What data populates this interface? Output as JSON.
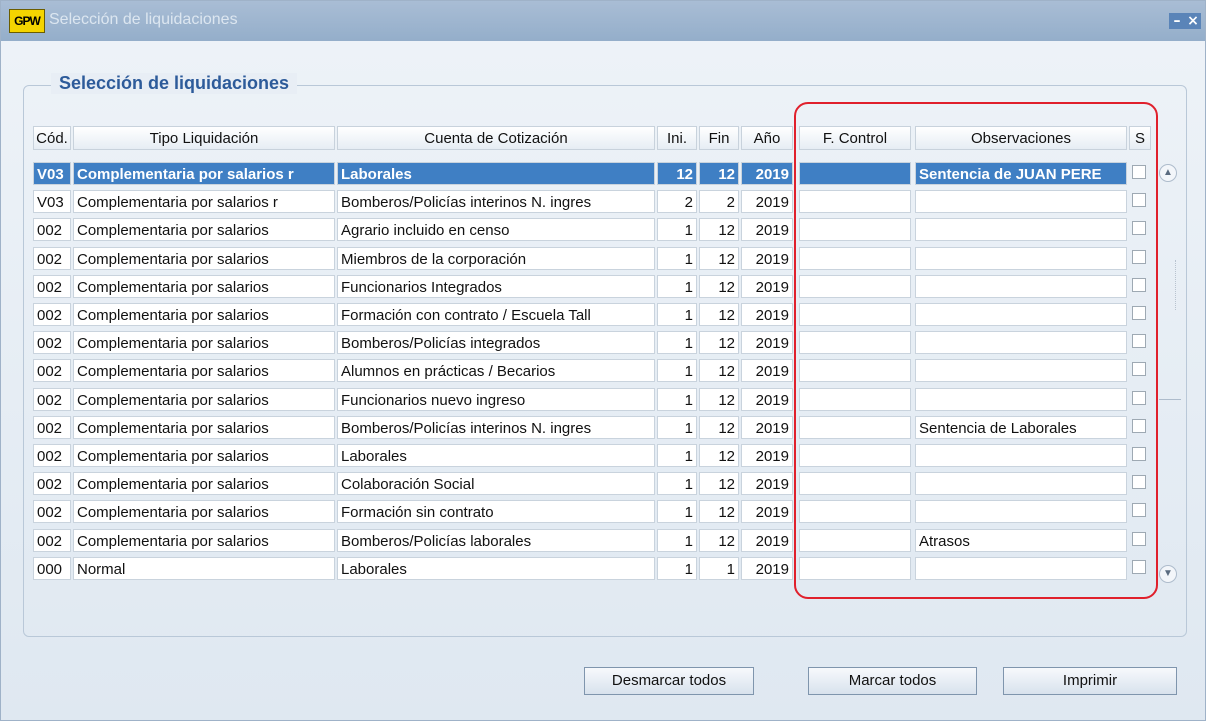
{
  "window": {
    "title": "Selección de liquidaciones",
    "app_icon": "GPW"
  },
  "section_title": "Selección de liquidaciones",
  "columns": [
    "Cód.",
    "Tipo Liquidación",
    "Cuenta de Cotización",
    "Ini.",
    "Fin",
    "Año",
    "F. Control",
    "Observaciones",
    "S"
  ],
  "rows": [
    {
      "cod": "V03",
      "tipo": "Complementaria por salarios r",
      "cuenta": "Laborales",
      "ini": "12",
      "fin": "12",
      "anio": "2019",
      "fcontrol": "",
      "obs": "Sentencia de JUAN PERE",
      "selected": true
    },
    {
      "cod": "V03",
      "tipo": "Complementaria por salarios r",
      "cuenta": "Bomberos/Policías interinos N. ingres",
      "ini": "2",
      "fin": "2",
      "anio": "2019",
      "fcontrol": "",
      "obs": "",
      "selected": false
    },
    {
      "cod": "002",
      "tipo": "Complementaria por salarios",
      "cuenta": "Agrario incluido en censo",
      "ini": "1",
      "fin": "12",
      "anio": "2019",
      "fcontrol": "",
      "obs": "",
      "selected": false
    },
    {
      "cod": "002",
      "tipo": "Complementaria por salarios",
      "cuenta": "Miembros de la corporación",
      "ini": "1",
      "fin": "12",
      "anio": "2019",
      "fcontrol": "",
      "obs": "",
      "selected": false
    },
    {
      "cod": "002",
      "tipo": "Complementaria por salarios",
      "cuenta": "Funcionarios Integrados",
      "ini": "1",
      "fin": "12",
      "anio": "2019",
      "fcontrol": "",
      "obs": "",
      "selected": false
    },
    {
      "cod": "002",
      "tipo": "Complementaria por salarios",
      "cuenta": "Formación con contrato / Escuela Tall",
      "ini": "1",
      "fin": "12",
      "anio": "2019",
      "fcontrol": "",
      "obs": "",
      "selected": false
    },
    {
      "cod": "002",
      "tipo": "Complementaria por salarios",
      "cuenta": "Bomberos/Policías integrados",
      "ini": "1",
      "fin": "12",
      "anio": "2019",
      "fcontrol": "",
      "obs": "",
      "selected": false
    },
    {
      "cod": "002",
      "tipo": "Complementaria por salarios",
      "cuenta": "Alumnos en prácticas / Becarios",
      "ini": "1",
      "fin": "12",
      "anio": "2019",
      "fcontrol": "",
      "obs": "",
      "selected": false
    },
    {
      "cod": "002",
      "tipo": "Complementaria por salarios",
      "cuenta": "Funcionarios nuevo ingreso",
      "ini": "1",
      "fin": "12",
      "anio": "2019",
      "fcontrol": "",
      "obs": "",
      "selected": false
    },
    {
      "cod": "002",
      "tipo": "Complementaria por salarios",
      "cuenta": "Bomberos/Policías interinos N. ingres",
      "ini": "1",
      "fin": "12",
      "anio": "2019",
      "fcontrol": "",
      "obs": "Sentencia de Laborales",
      "selected": false
    },
    {
      "cod": "002",
      "tipo": "Complementaria por salarios",
      "cuenta": "Laborales",
      "ini": "1",
      "fin": "12",
      "anio": "2019",
      "fcontrol": "",
      "obs": "",
      "selected": false
    },
    {
      "cod": "002",
      "tipo": "Complementaria por salarios",
      "cuenta": "Colaboración Social",
      "ini": "1",
      "fin": "12",
      "anio": "2019",
      "fcontrol": "",
      "obs": "",
      "selected": false
    },
    {
      "cod": "002",
      "tipo": "Complementaria por salarios",
      "cuenta": "Formación sin contrato",
      "ini": "1",
      "fin": "12",
      "anio": "2019",
      "fcontrol": "",
      "obs": "",
      "selected": false
    },
    {
      "cod": "002",
      "tipo": "Complementaria por salarios",
      "cuenta": "Bomberos/Policías laborales",
      "ini": "1",
      "fin": "12",
      "anio": "2019",
      "fcontrol": "",
      "obs": "Atrasos",
      "selected": false
    },
    {
      "cod": "000",
      "tipo": "Normal",
      "cuenta": "Laborales",
      "ini": "1",
      "fin": "1",
      "anio": "2019",
      "fcontrol": "",
      "obs": "",
      "selected": false
    }
  ],
  "buttons": {
    "desmarcar": "Desmarcar todos",
    "marcar": "Marcar todos",
    "imprimir": "Imprimir"
  },
  "colors": {
    "highlight": "#3f7fc4",
    "annotation": "#e0202c"
  }
}
